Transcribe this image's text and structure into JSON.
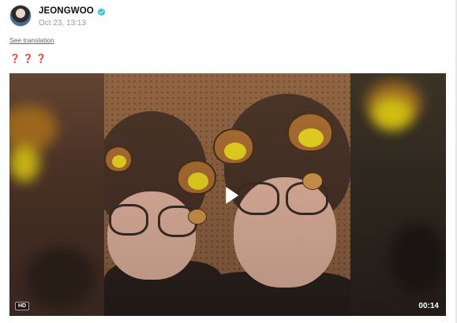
{
  "post": {
    "author": "JEONGWOO",
    "verified": true,
    "timestamp": "Oct 23, 13:13",
    "translate_label": "See translation",
    "text": "❓❓❓"
  },
  "video": {
    "hd_label": "HD",
    "duration": "00:14",
    "play_icon": "play-icon"
  },
  "colors": {
    "verified_badge": "#2ec4d6",
    "question_marks": "#d6283e",
    "timestamp": "#9a9a9a"
  }
}
